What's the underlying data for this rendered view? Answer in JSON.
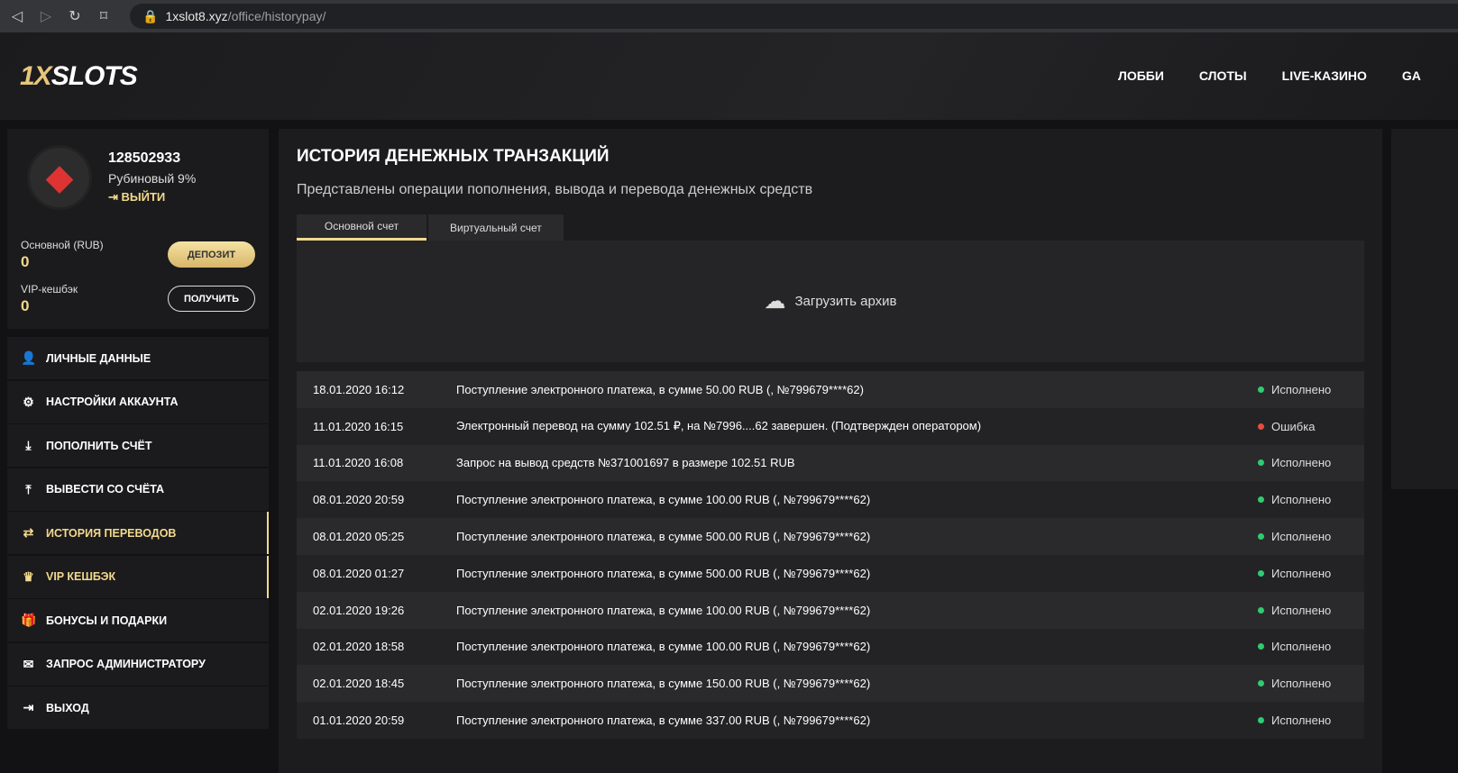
{
  "browser": {
    "domain": "1xslot8.xyz",
    "path": "/office/historypay/"
  },
  "header": {
    "logo_a": "1X",
    "logo_b": "SLOTS",
    "nav": [
      "ЛОББИ",
      "СЛОТЫ",
      "LIVE-КАЗИНО",
      "GA"
    ]
  },
  "profile": {
    "id": "128502933",
    "rank": "Рубиновый 9%",
    "logout": "ВЫЙТИ",
    "main_label": "Основной (RUB)",
    "main_value": "0",
    "vip_label": "VIP-кешбэк",
    "vip_value": "0",
    "deposit": "ДЕПОЗИТ",
    "receive": "ПОЛУЧИТЬ"
  },
  "menu": [
    {
      "label": "ЛИЧНЫЕ ДАННЫЕ",
      "icon": "👤"
    },
    {
      "label": "НАСТРОЙКИ АККАУНТА",
      "icon": "⚙"
    },
    {
      "label": "ПОПОЛНИТЬ СЧЁТ",
      "icon": "⤓"
    },
    {
      "label": "ВЫВЕСТИ СО СЧЁТА",
      "icon": "⤒"
    },
    {
      "label": "ИСТОРИЯ ПЕРЕВОДОВ",
      "icon": "⇄"
    },
    {
      "label": "VIP КЕШБЭК",
      "icon": "♛"
    },
    {
      "label": "БОНУСЫ И ПОДАРКИ",
      "icon": "🎁"
    },
    {
      "label": "ЗАПРОС АДМИНИСТРАТОРУ",
      "icon": "✉"
    },
    {
      "label": "ВЫХОД",
      "icon": "⇥"
    }
  ],
  "main": {
    "title": "ИСТОРИЯ ДЕНЕЖНЫХ ТРАНЗАКЦИЙ",
    "subtitle": "Представлены операции пополнения, вывода и перевода денежных средств",
    "tabs": [
      "Основной счет",
      "Виртуальный счет"
    ],
    "upload": "Загрузить архив",
    "colors": {
      "ok": "#2ecc71",
      "err": "#e74c3c"
    },
    "rows": [
      {
        "date": "18.01.2020 16:12",
        "text": "Поступление электронного платежа, в сумме 50.00 RUB (, №799679****62)",
        "status": "Исполнено",
        "ok": true
      },
      {
        "date": "11.01.2020 16:15",
        "text": "Электронный перевод на сумму 102.51 ₽, на №7996....62 завершен. (Подтвержден оператором)",
        "status": "Ошибка",
        "ok": false
      },
      {
        "date": "11.01.2020 16:08",
        "text": "Запрос на вывод средств №371001697 в размере 102.51 RUB",
        "status": "Исполнено",
        "ok": true
      },
      {
        "date": "08.01.2020 20:59",
        "text": "Поступление электронного платежа, в сумме 100.00 RUB (, №799679****62)",
        "status": "Исполнено",
        "ok": true
      },
      {
        "date": "08.01.2020 05:25",
        "text": "Поступление электронного платежа, в сумме 500.00 RUB (, №799679****62)",
        "status": "Исполнено",
        "ok": true
      },
      {
        "date": "08.01.2020 01:27",
        "text": "Поступление электронного платежа, в сумме 500.00 RUB (, №799679****62)",
        "status": "Исполнено",
        "ok": true
      },
      {
        "date": "02.01.2020 19:26",
        "text": "Поступление электронного платежа, в сумме 100.00 RUB (, №799679****62)",
        "status": "Исполнено",
        "ok": true
      },
      {
        "date": "02.01.2020 18:58",
        "text": "Поступление электронного платежа, в сумме 100.00 RUB (, №799679****62)",
        "status": "Исполнено",
        "ok": true
      },
      {
        "date": "02.01.2020 18:45",
        "text": "Поступление электронного платежа, в сумме 150.00 RUB (, №799679****62)",
        "status": "Исполнено",
        "ok": true
      },
      {
        "date": "01.01.2020 20:59",
        "text": "Поступление электронного платежа, в сумме 337.00 RUB (, №799679****62)",
        "status": "Исполнено",
        "ok": true
      }
    ]
  }
}
